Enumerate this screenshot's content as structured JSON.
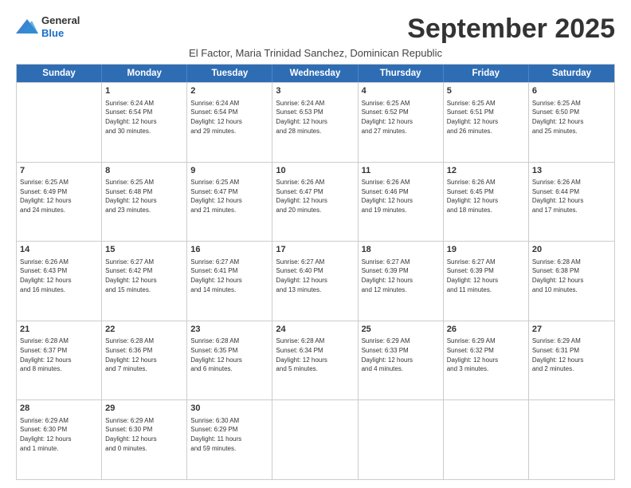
{
  "header": {
    "logo_line1": "General",
    "logo_line2": "Blue",
    "month": "September 2025",
    "location": "El Factor, Maria Trinidad Sanchez, Dominican Republic"
  },
  "days_of_week": [
    "Sunday",
    "Monday",
    "Tuesday",
    "Wednesday",
    "Thursday",
    "Friday",
    "Saturday"
  ],
  "weeks": [
    [
      {
        "day": null,
        "info": ""
      },
      {
        "day": "1",
        "info": "Sunrise: 6:24 AM\nSunset: 6:54 PM\nDaylight: 12 hours\nand 30 minutes."
      },
      {
        "day": "2",
        "info": "Sunrise: 6:24 AM\nSunset: 6:54 PM\nDaylight: 12 hours\nand 29 minutes."
      },
      {
        "day": "3",
        "info": "Sunrise: 6:24 AM\nSunset: 6:53 PM\nDaylight: 12 hours\nand 28 minutes."
      },
      {
        "day": "4",
        "info": "Sunrise: 6:25 AM\nSunset: 6:52 PM\nDaylight: 12 hours\nand 27 minutes."
      },
      {
        "day": "5",
        "info": "Sunrise: 6:25 AM\nSunset: 6:51 PM\nDaylight: 12 hours\nand 26 minutes."
      },
      {
        "day": "6",
        "info": "Sunrise: 6:25 AM\nSunset: 6:50 PM\nDaylight: 12 hours\nand 25 minutes."
      }
    ],
    [
      {
        "day": "7",
        "info": "Sunrise: 6:25 AM\nSunset: 6:49 PM\nDaylight: 12 hours\nand 24 minutes."
      },
      {
        "day": "8",
        "info": "Sunrise: 6:25 AM\nSunset: 6:48 PM\nDaylight: 12 hours\nand 23 minutes."
      },
      {
        "day": "9",
        "info": "Sunrise: 6:25 AM\nSunset: 6:47 PM\nDaylight: 12 hours\nand 21 minutes."
      },
      {
        "day": "10",
        "info": "Sunrise: 6:26 AM\nSunset: 6:47 PM\nDaylight: 12 hours\nand 20 minutes."
      },
      {
        "day": "11",
        "info": "Sunrise: 6:26 AM\nSunset: 6:46 PM\nDaylight: 12 hours\nand 19 minutes."
      },
      {
        "day": "12",
        "info": "Sunrise: 6:26 AM\nSunset: 6:45 PM\nDaylight: 12 hours\nand 18 minutes."
      },
      {
        "day": "13",
        "info": "Sunrise: 6:26 AM\nSunset: 6:44 PM\nDaylight: 12 hours\nand 17 minutes."
      }
    ],
    [
      {
        "day": "14",
        "info": "Sunrise: 6:26 AM\nSunset: 6:43 PM\nDaylight: 12 hours\nand 16 minutes."
      },
      {
        "day": "15",
        "info": "Sunrise: 6:27 AM\nSunset: 6:42 PM\nDaylight: 12 hours\nand 15 minutes."
      },
      {
        "day": "16",
        "info": "Sunrise: 6:27 AM\nSunset: 6:41 PM\nDaylight: 12 hours\nand 14 minutes."
      },
      {
        "day": "17",
        "info": "Sunrise: 6:27 AM\nSunset: 6:40 PM\nDaylight: 12 hours\nand 13 minutes."
      },
      {
        "day": "18",
        "info": "Sunrise: 6:27 AM\nSunset: 6:39 PM\nDaylight: 12 hours\nand 12 minutes."
      },
      {
        "day": "19",
        "info": "Sunrise: 6:27 AM\nSunset: 6:39 PM\nDaylight: 12 hours\nand 11 minutes."
      },
      {
        "day": "20",
        "info": "Sunrise: 6:28 AM\nSunset: 6:38 PM\nDaylight: 12 hours\nand 10 minutes."
      }
    ],
    [
      {
        "day": "21",
        "info": "Sunrise: 6:28 AM\nSunset: 6:37 PM\nDaylight: 12 hours\nand 8 minutes."
      },
      {
        "day": "22",
        "info": "Sunrise: 6:28 AM\nSunset: 6:36 PM\nDaylight: 12 hours\nand 7 minutes."
      },
      {
        "day": "23",
        "info": "Sunrise: 6:28 AM\nSunset: 6:35 PM\nDaylight: 12 hours\nand 6 minutes."
      },
      {
        "day": "24",
        "info": "Sunrise: 6:28 AM\nSunset: 6:34 PM\nDaylight: 12 hours\nand 5 minutes."
      },
      {
        "day": "25",
        "info": "Sunrise: 6:29 AM\nSunset: 6:33 PM\nDaylight: 12 hours\nand 4 minutes."
      },
      {
        "day": "26",
        "info": "Sunrise: 6:29 AM\nSunset: 6:32 PM\nDaylight: 12 hours\nand 3 minutes."
      },
      {
        "day": "27",
        "info": "Sunrise: 6:29 AM\nSunset: 6:31 PM\nDaylight: 12 hours\nand 2 minutes."
      }
    ],
    [
      {
        "day": "28",
        "info": "Sunrise: 6:29 AM\nSunset: 6:30 PM\nDaylight: 12 hours\nand 1 minute."
      },
      {
        "day": "29",
        "info": "Sunrise: 6:29 AM\nSunset: 6:30 PM\nDaylight: 12 hours\nand 0 minutes."
      },
      {
        "day": "30",
        "info": "Sunrise: 6:30 AM\nSunset: 6:29 PM\nDaylight: 11 hours\nand 59 minutes."
      },
      {
        "day": null,
        "info": ""
      },
      {
        "day": null,
        "info": ""
      },
      {
        "day": null,
        "info": ""
      },
      {
        "day": null,
        "info": ""
      }
    ]
  ]
}
